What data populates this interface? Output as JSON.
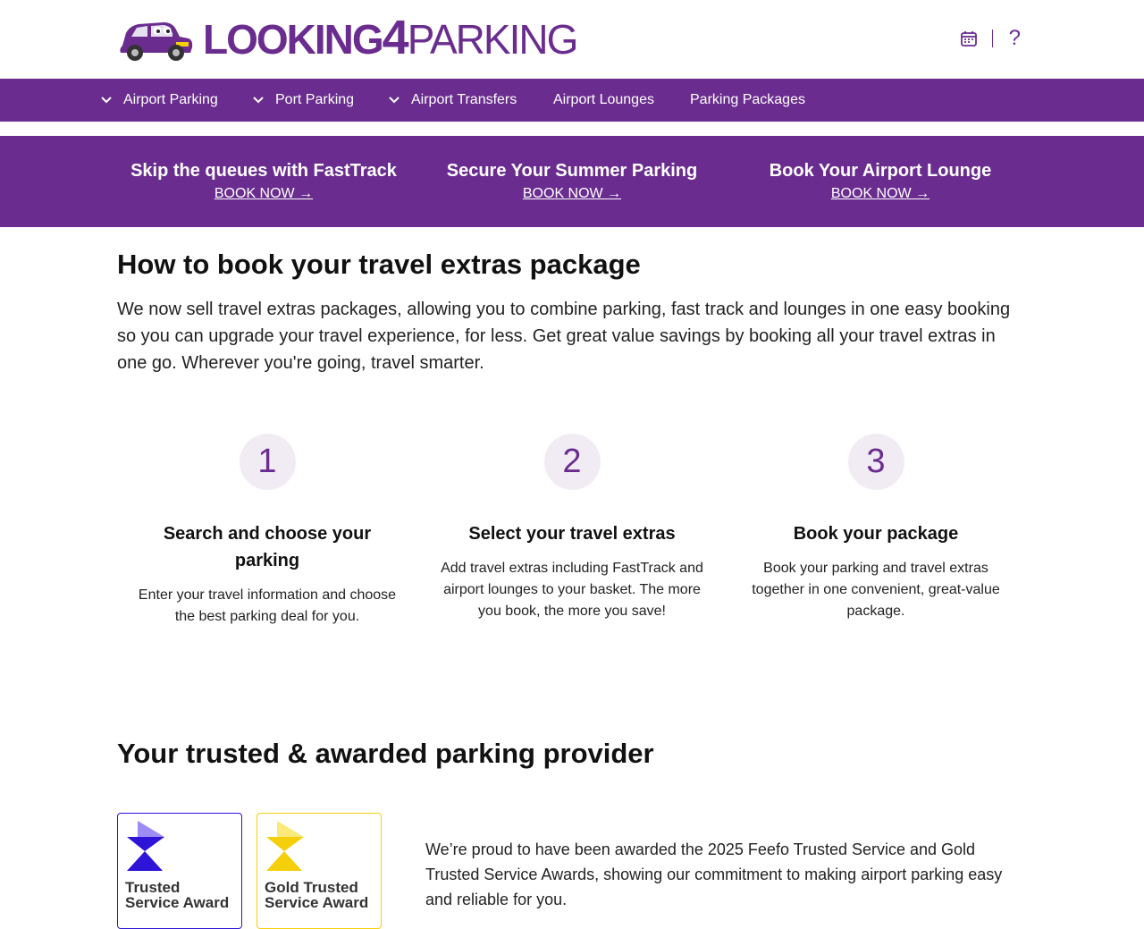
{
  "header": {
    "logo": {
      "part1": "LOOKING",
      "part2": "4",
      "part3": "PARKING"
    },
    "icons": {
      "calendar": "calendar-icon",
      "help": "?"
    }
  },
  "nav": [
    {
      "label": "Airport Parking",
      "has_dropdown": true
    },
    {
      "label": "Port Parking",
      "has_dropdown": true
    },
    {
      "label": "Airport Transfers",
      "has_dropdown": true
    },
    {
      "label": "Airport Lounges",
      "has_dropdown": false
    },
    {
      "label": "Parking Packages",
      "has_dropdown": false
    }
  ],
  "promos": [
    {
      "title": "Skip the queues with FastTrack",
      "link": "BOOK NOW →"
    },
    {
      "title": "Secure Your Summer Parking",
      "link": "BOOK NOW →"
    },
    {
      "title": "Book Your Airport Lounge",
      "link": "BOOK NOW →"
    }
  ],
  "how_to": {
    "heading": "How to book your travel extras package",
    "intro": "We now sell travel extras packages, allowing you to combine parking, fast track and lounges in one easy booking so you can upgrade your travel experience, for less. Get great value savings by booking all your travel extras in one go. Wherever you're going, travel smarter.",
    "steps": [
      {
        "number": "1",
        "title": "Search and choose your parking",
        "text": "Enter your travel information and choose the best parking deal for you."
      },
      {
        "number": "2",
        "title": "Select your travel extras",
        "text": "Add travel extras including FastTrack and airport lounges to your basket. The more you book, the more you save!"
      },
      {
        "number": "3",
        "title": "Book your package",
        "text": "Book your parking and travel extras together in one convenient, great-value package."
      }
    ]
  },
  "trusted": {
    "heading": "Your trusted & awarded parking provider",
    "badges": [
      {
        "line1": "Trusted",
        "line2": "Service Award"
      },
      {
        "line1": "Gold Trusted",
        "line2": "Service Award"
      }
    ],
    "text": "We’re proud to have been awarded the 2025 Feefo Trusted Service and Gold Trusted Service Awards, showing our commitment to making airport parking easy and reliable for you."
  },
  "colors": {
    "brand": "#6a2d8f",
    "circle_bg": "#f1ecf4",
    "trusted_blue": "#2d14d6",
    "gold": "#f5d00a"
  }
}
